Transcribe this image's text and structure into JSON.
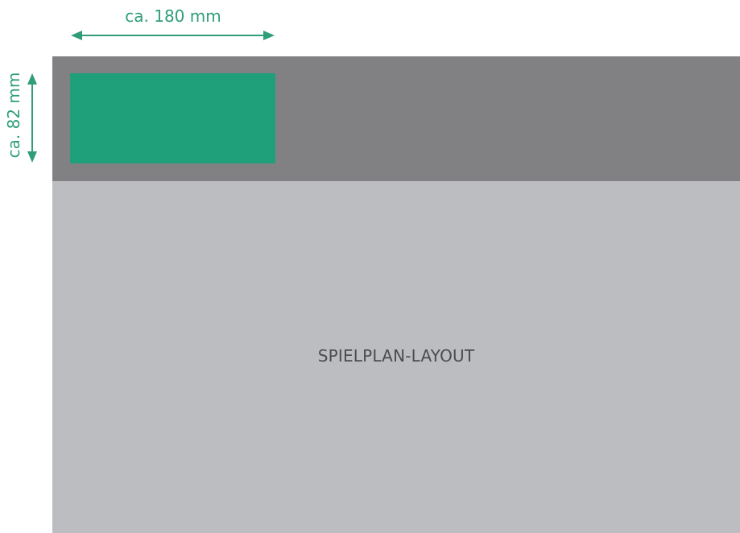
{
  "diagram": {
    "width_dimension_label": "ca. 180 mm",
    "height_dimension_label": "ca. 82 mm",
    "main_area_label": "SPIELPLAN-LAYOUT"
  },
  "colors": {
    "accent": "#2f9e77",
    "green_box": "#1fa07a",
    "header_band": "#818184",
    "main_area": "#bcbdc1",
    "label_text": "#4c4c4e"
  }
}
